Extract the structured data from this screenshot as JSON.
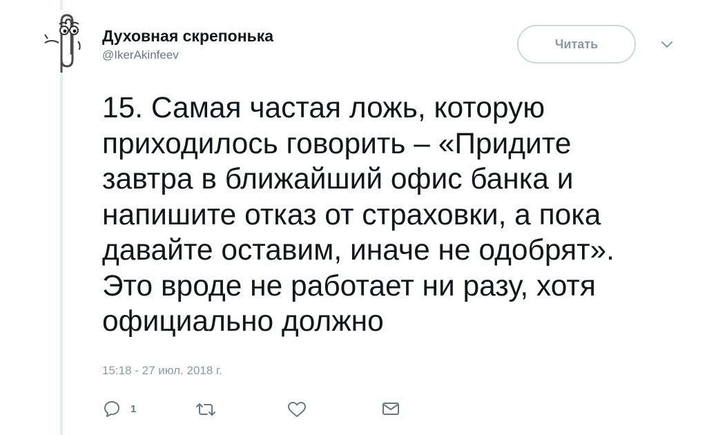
{
  "user": {
    "display_name": "Духовная скрепонька",
    "handle": "@IkerAkinfeev"
  },
  "follow_button": {
    "label": "Читать"
  },
  "tweet": {
    "text": "15. Самая частая ложь, которую\nприходилось говорить – «Придите\nзавтра в ближайший офис банка и\nнапишите отказ от страховки, а пока\nдавайте оставим, иначе не одобрят».\nЭто вроде не работает ни разу, хотя\nофициально должно",
    "timestamp": "15:18 - 27 июл. 2018 г."
  },
  "actions": {
    "reply_count": "1"
  },
  "icons": {
    "avatar": "paperclip-character-icon",
    "menu": "chevron-down-icon",
    "reply": "reply-bubble-icon",
    "retweet": "retweet-icon",
    "like": "heart-icon",
    "dm": "envelope-icon"
  },
  "colors": {
    "text": "#14171a",
    "secondary": "#657786",
    "muted": "#8899a6",
    "border": "#ccd6dd",
    "thread_line": "#e6ecf0"
  }
}
